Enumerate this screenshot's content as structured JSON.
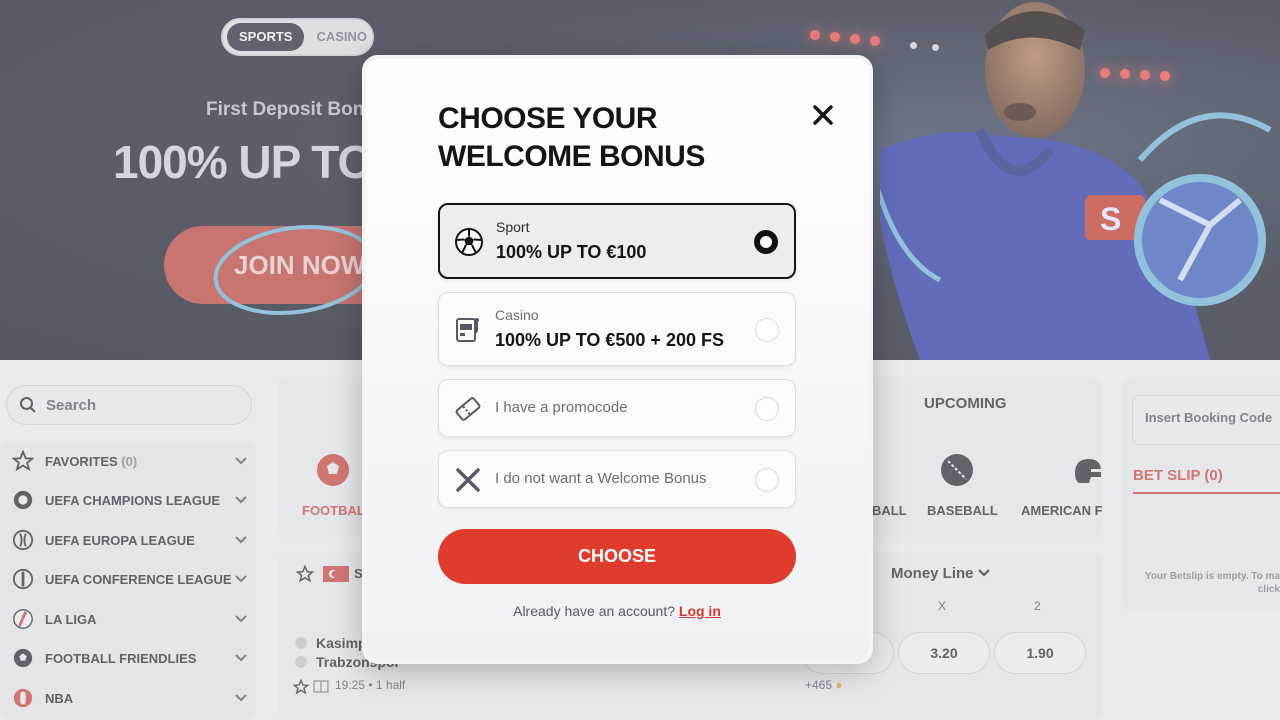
{
  "hero": {
    "toggle": {
      "sports": "SPORTS",
      "casino": "CASINO"
    },
    "subtitle": "First Deposit Bon",
    "headline": "100% UP TO",
    "cta": "JOIN NOW"
  },
  "search": {
    "placeholder": "Search"
  },
  "sidebar": {
    "items": [
      {
        "label": "FAVORITES",
        "count": "(0)",
        "icon": "star-icon"
      },
      {
        "label": "UEFA CHAMPIONS LEAGUE",
        "icon": "champions-league-icon"
      },
      {
        "label": "UEFA EUROPA LEAGUE",
        "icon": "europa-league-icon"
      },
      {
        "label": "UEFA CONFERENCE LEAGUE",
        "icon": "conference-league-icon"
      },
      {
        "label": "LA LIGA",
        "icon": "la-liga-icon"
      },
      {
        "label": "FOOTBALL FRIENDLIES",
        "icon": "football-icon"
      },
      {
        "label": "NBA",
        "icon": "nba-icon"
      }
    ]
  },
  "main": {
    "upcoming_label": "UPCOMING",
    "sports": [
      {
        "label": "FOOTBAL",
        "icon": "football-icon"
      },
      {
        "label": "BALL",
        "icon": "ball-icon"
      },
      {
        "label": "BASEBALL",
        "icon": "baseball-icon"
      },
      {
        "label": "AMERICAN F",
        "icon": "american-football-icon"
      }
    ],
    "league_abbrev": "S",
    "market": "Money Line",
    "columns": {
      "x": "X",
      "two": "2"
    },
    "match": {
      "team1": "Kasimp",
      "team2": "Trabzonspor",
      "time": "19:25 • 1 half",
      "odds": [
        "3.20",
        "1.90"
      ],
      "more": "+465"
    }
  },
  "betslip": {
    "booking_placeholder": "Insert Booking Code",
    "title": "BET SLIP (0)",
    "empty_line1": "Your Betslip is empty. To ma",
    "empty_line2": "click"
  },
  "modal": {
    "title": "CHOOSE YOUR WELCOME BONUS",
    "options": [
      {
        "small": "Sport",
        "big": "100% UP TO €100",
        "icon": "soccer-ball-icon",
        "selected": true
      },
      {
        "small": "Casino",
        "big": "100% UP TO €500 + 200 FS",
        "icon": "slot-machine-icon",
        "selected": false
      },
      {
        "text": "I have a promocode",
        "icon": "ticket-icon",
        "selected": false
      },
      {
        "text": "I do not want a Welcome Bonus",
        "icon": "cross-icon",
        "selected": false
      }
    ],
    "choose_label": "CHOOSE",
    "already_text": "Already have an account?",
    "login_label": "Log in"
  },
  "colors": {
    "accent": "#e03c2e",
    "dark": "#141419",
    "betslip": "#c54640"
  }
}
